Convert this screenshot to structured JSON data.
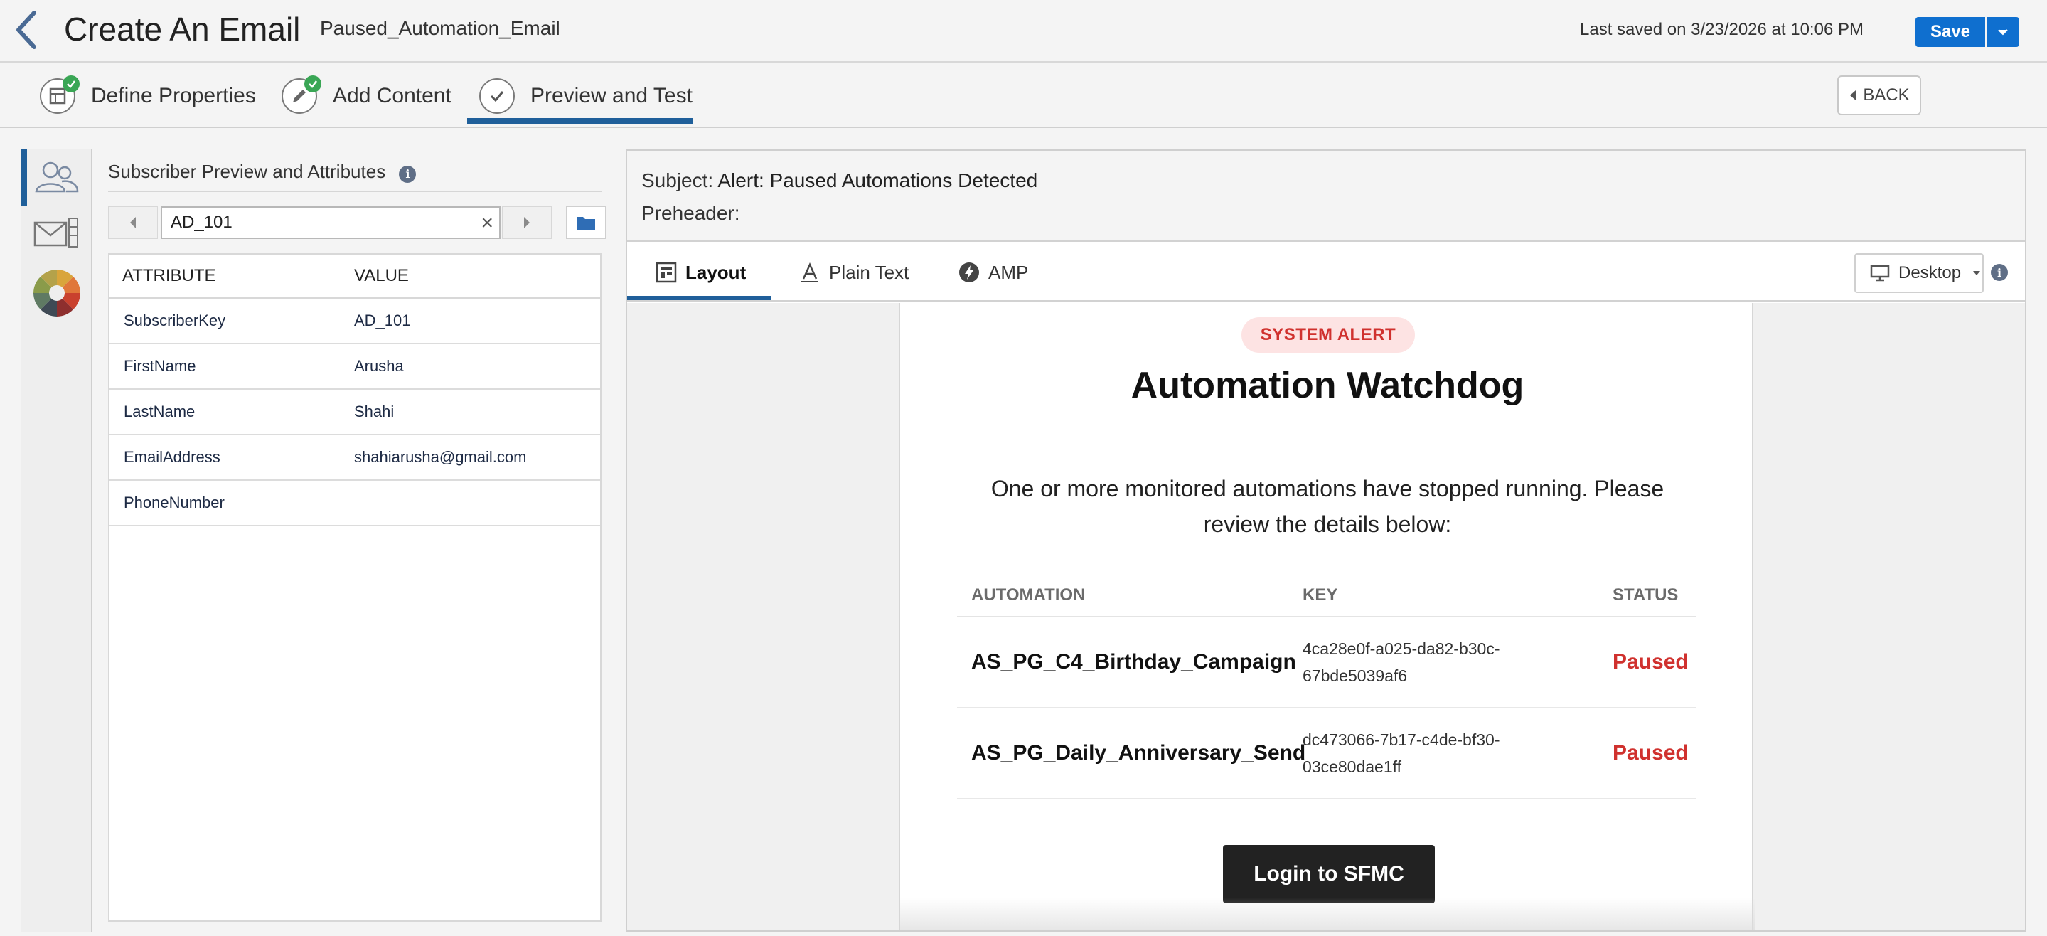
{
  "header": {
    "title": "Create An Email",
    "email_name": "Paused_Automation_Email",
    "last_saved": "Last saved on 3/23/2026 at 10:06 PM",
    "save_label": "Save"
  },
  "steps": [
    {
      "label": "Define Properties",
      "icon": "define-properties-icon",
      "complete": true
    },
    {
      "label": "Add Content",
      "icon": "add-content-icon",
      "complete": true
    },
    {
      "label": "Preview and Test",
      "icon": "preview-test-icon",
      "active": true
    }
  ],
  "back_label": "BACK",
  "attributes_panel": {
    "title": "Subscriber Preview and Attributes",
    "subscriber_value": "AD_101",
    "columns": [
      "ATTRIBUTE",
      "VALUE"
    ],
    "rows": [
      {
        "attribute": "SubscriberKey",
        "value": "AD_101"
      },
      {
        "attribute": "FirstName",
        "value": "Arusha"
      },
      {
        "attribute": "LastName",
        "value": "Shahi"
      },
      {
        "attribute": "EmailAddress",
        "value": "shahiarusha@gmail.com"
      },
      {
        "attribute": "PhoneNumber",
        "value": ""
      }
    ]
  },
  "preview": {
    "subject_label": "Subject:",
    "subject": "Alert: Paused Automations Detected",
    "preheader_label": "Preheader:",
    "preheader": "",
    "tabs": [
      "Layout",
      "Plain Text",
      "AMP"
    ],
    "device": "Desktop"
  },
  "email": {
    "badge": "SYSTEM ALERT",
    "title": "Automation Watchdog",
    "intro": "One or more monitored automations have stopped running. Please review the details below:",
    "columns": [
      "AUTOMATION",
      "KEY",
      "STATUS"
    ],
    "rows": [
      {
        "name": "AS_PG_C4_Birthday_Campaign",
        "key_line1": "4ca28e0f-a025-da82-b30c-",
        "key_line2": "67bde5039af6",
        "status": "Paused"
      },
      {
        "name": "AS_PG_Daily_Anniversary_Send",
        "key_line1": "dc473066-7b17-c4de-bf30-",
        "key_line2": "03ce80dae1ff",
        "status": "Paused"
      }
    ],
    "button": "Login to SFMC"
  },
  "colors": {
    "brand_blue": "#0f6fcf",
    "tab_underline": "#1f5f9a",
    "alert_red": "#d0312e",
    "alert_pill_bg": "#fde3e3",
    "success_green": "#3aa655"
  }
}
